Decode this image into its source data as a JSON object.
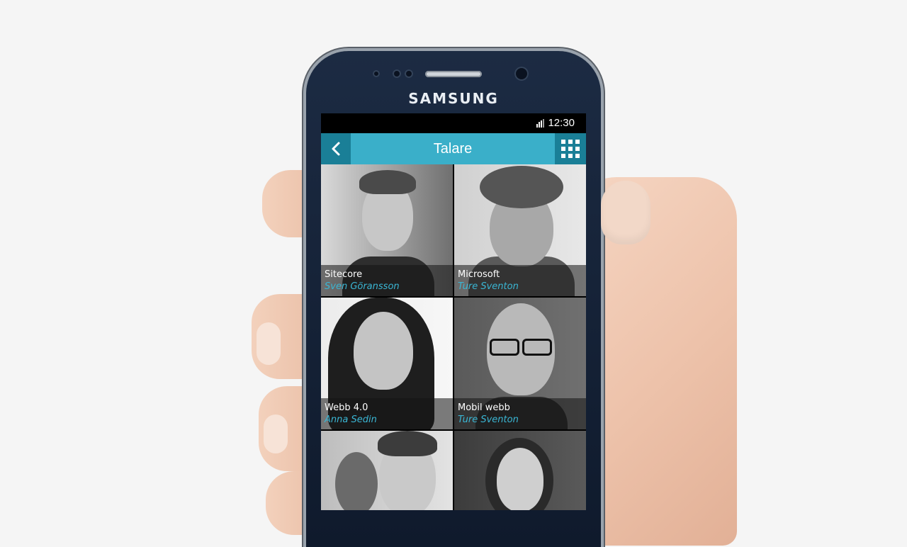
{
  "device": {
    "brand": "SAMSUNG"
  },
  "status_bar": {
    "time": "12:30"
  },
  "app_bar": {
    "title": "Talare"
  },
  "speakers": [
    {
      "topic": "Sitecore",
      "name": "Sven Göransson"
    },
    {
      "topic": "Microsoft",
      "name": "Ture Sventon"
    },
    {
      "topic": "Webb 4.0",
      "name": "Anna Sedin"
    },
    {
      "topic": "Mobil webb",
      "name": "Ture Sventon"
    }
  ],
  "colors": {
    "accent": "#3aafc9",
    "accent_dark": "#1a7f97",
    "name_text": "#3ab6d4"
  },
  "icons": {
    "back": "chevron-left-icon",
    "menu": "grid-icon",
    "signal": "signal-icon"
  }
}
